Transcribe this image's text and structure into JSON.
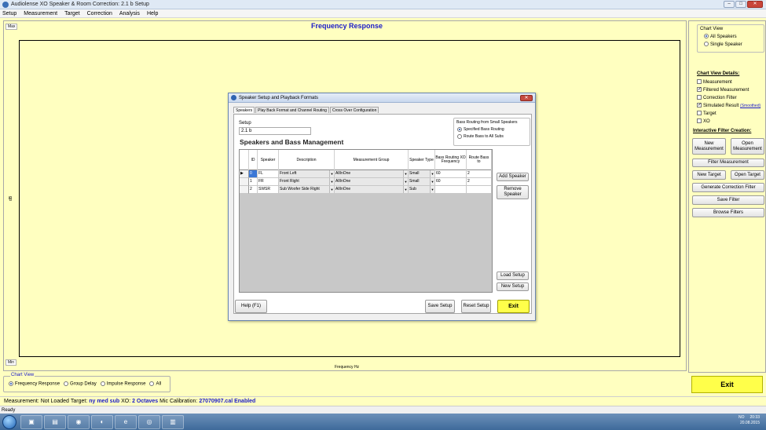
{
  "window": {
    "title": "Audiolense XO Speaker & Room Correction: 2.1 b Setup",
    "buttons": {
      "minimize": "–",
      "maximize": "□",
      "close": "✕"
    }
  },
  "menu": [
    "Setup",
    "Measurement",
    "Target",
    "Correction",
    "Analysis",
    "Help"
  ],
  "chart": {
    "title": "Frequency Response",
    "y_max_label": "Max",
    "y_min_label": "Min",
    "x_label": "Frequency Hz",
    "y_side_label": "dB"
  },
  "right_panel": {
    "chart_view": {
      "legend": "Chart View",
      "options": [
        {
          "label": "All Speakers",
          "selected": true
        },
        {
          "label": "Single Speaker",
          "selected": false
        }
      ]
    },
    "details_title": "Chart View Details:",
    "details": [
      {
        "label": "Measurement",
        "checked": false
      },
      {
        "label": "Filtered Measurement",
        "checked": true
      },
      {
        "label": "Correction Filter",
        "checked": false
      },
      {
        "label": "Simulated Result",
        "checked": true,
        "link": "(Smoothed)"
      },
      {
        "label": "Target",
        "checked": false
      },
      {
        "label": "XO",
        "checked": false
      }
    ],
    "interactive_title": "Interactive Filter Creation:",
    "buttons": {
      "new_measurement": "New Measurement",
      "open_measurement": "Open Measurement",
      "filter_measurement": "Filter Measurement",
      "new_target": "New Target",
      "open_target": "Open Target",
      "generate_correction_filter": "Generate Correction Filter",
      "save_filter": "Save Filter",
      "browse_filters": "Browse Filters"
    },
    "exit": "Exit"
  },
  "bottom_chart_view": {
    "legend": "Chart View",
    "options": [
      {
        "label": "Frequency Response",
        "selected": true
      },
      {
        "label": "Group Delay",
        "selected": false
      },
      {
        "label": "Impulse Response",
        "selected": false
      },
      {
        "label": "All",
        "selected": false
      }
    ]
  },
  "status": {
    "measurement_label": "Measurement:",
    "measurement_value": "Not Loaded",
    "target_label": "Target:",
    "target_value": "ny med sub",
    "xo_label": "XO:",
    "xo_value": "2 Octaves",
    "mic_label": "Mic Calibration:",
    "mic_value": "27070907.cal Enabled",
    "ready": "Ready"
  },
  "dialog": {
    "title": "Speaker Setup and Playback Formats",
    "close": "✕",
    "tabs": [
      {
        "label": "Speakers",
        "selected": true
      },
      {
        "label": "Play Back Format and Channel Routing",
        "selected": false
      },
      {
        "label": "Cross Over Configuration",
        "selected": false
      }
    ],
    "setup_label": "Setup",
    "setup_value": "2.1 b",
    "heading": "Speakers and Bass Management",
    "bass_routing": {
      "title": "Bass Routing from Small Speakers",
      "options": [
        {
          "label": "Specified Bass Routing",
          "selected": true
        },
        {
          "label": "Route Bass to All Subs",
          "selected": false
        }
      ]
    },
    "grid": {
      "columns": [
        "ID",
        "Speaker",
        "Description",
        "Measurement Group",
        "Speaker Type",
        "Bass Routing XO Frequency",
        "Route Bass to"
      ],
      "rows": [
        {
          "id": "0",
          "speaker": "FL",
          "description": "Front Left",
          "group": "AllInOne",
          "type": "Small",
          "xo": "60",
          "route": "2"
        },
        {
          "id": "1",
          "speaker": "FR",
          "description": "Front Right",
          "group": "AllInOne",
          "type": "Small",
          "xo": "60",
          "route": "2"
        },
        {
          "id": "2",
          "speaker": "SWSR",
          "description": "Sub Woofer Side Right",
          "group": "AllInOne",
          "type": "Sub",
          "xo": "",
          "route": ""
        }
      ]
    },
    "buttons": {
      "add_speaker": "Add Speaker",
      "remove_speaker": "Remove Speaker",
      "load_setup": "Load Setup",
      "new_setup": "New Setup",
      "help": "Help (F1)",
      "save_setup": "Save Setup",
      "reset_setup": "Reset Setup",
      "exit": "Exit"
    }
  },
  "taskbar": {
    "tray_lang": "NO",
    "time": "20:33",
    "date": "20.08.2015"
  },
  "colors": {
    "background": "#ffffc0",
    "accent_blue": "#1a1ac8",
    "exit_yellow": "#ffff4a"
  }
}
